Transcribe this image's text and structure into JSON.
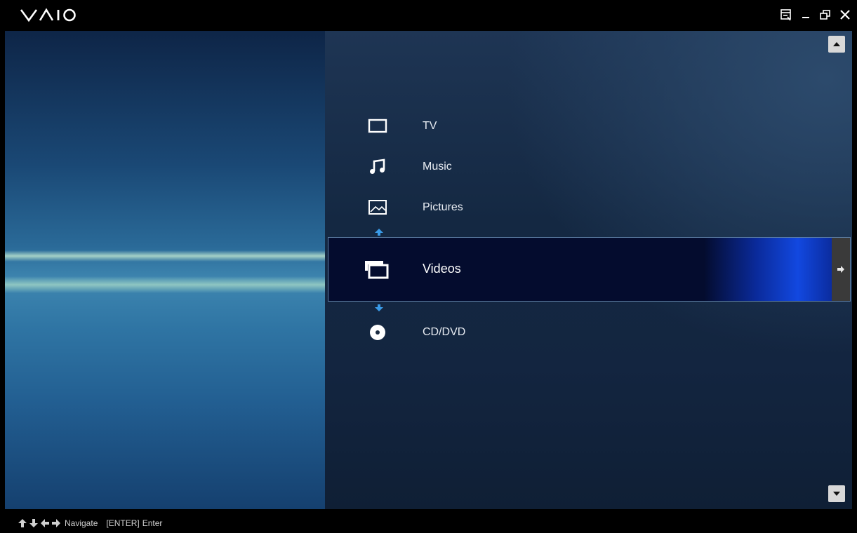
{
  "app": {
    "brand": "VAIO"
  },
  "window_controls": [
    "mini-mode-icon",
    "minimize-icon",
    "restore-icon",
    "close-icon"
  ],
  "menu": {
    "items": [
      {
        "label": "TV",
        "icon": "tv-icon"
      },
      {
        "label": "Music",
        "icon": "music-note-icon"
      },
      {
        "label": "Pictures",
        "icon": "picture-icon"
      },
      {
        "label": "Videos",
        "icon": "film-icon",
        "selected": true
      },
      {
        "label": "CD/DVD",
        "icon": "disc-icon"
      }
    ]
  },
  "footer": {
    "navigate_label": "Navigate",
    "enter_key": "[ENTER]",
    "enter_label": "Enter"
  },
  "colors": {
    "selection_bg": "#040c2e",
    "selection_glow": "#1248e0",
    "accent_arrow": "#3a9be8"
  }
}
